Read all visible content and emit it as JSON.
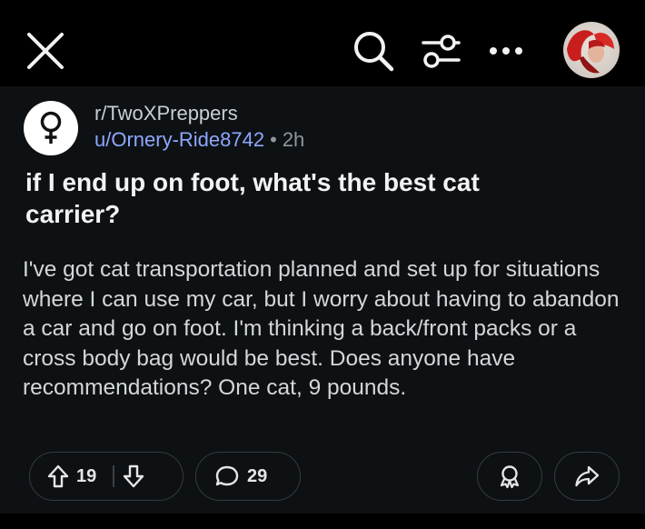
{
  "header": {
    "close_icon": "close-icon",
    "search_icon": "search-icon",
    "filter_icon": "sort-filter-icon",
    "more_icon": "more-horizontal-icon",
    "avatar": "user-avatar"
  },
  "post": {
    "community_icon": "female-symbol-icon",
    "subreddit": "r/TwoXPreppers",
    "author": "u/Ornery-Ride8742",
    "separator": "•",
    "age": "2h",
    "title": "if I end up on foot, what's the best cat carrier?",
    "body": "I've got cat transportation planned and set up for situations where I can use my car, but I worry about having to abandon a car and go on foot.  I'm thinking a back/front packs or a cross body bag would be best.  Does anyone have recommendations?  One cat, 9 pounds."
  },
  "actions": {
    "upvotes": "19",
    "comments": "29",
    "upvote_icon": "arrow-up-icon",
    "downvote_icon": "arrow-down-icon",
    "comment_icon": "speech-bubble-icon",
    "award_icon": "award-icon",
    "share_icon": "share-arrow-icon"
  },
  "colors": {
    "background": "#000000",
    "post_background": "#0e1113",
    "username": "#8ea7ff",
    "text": "#d3d7da"
  }
}
